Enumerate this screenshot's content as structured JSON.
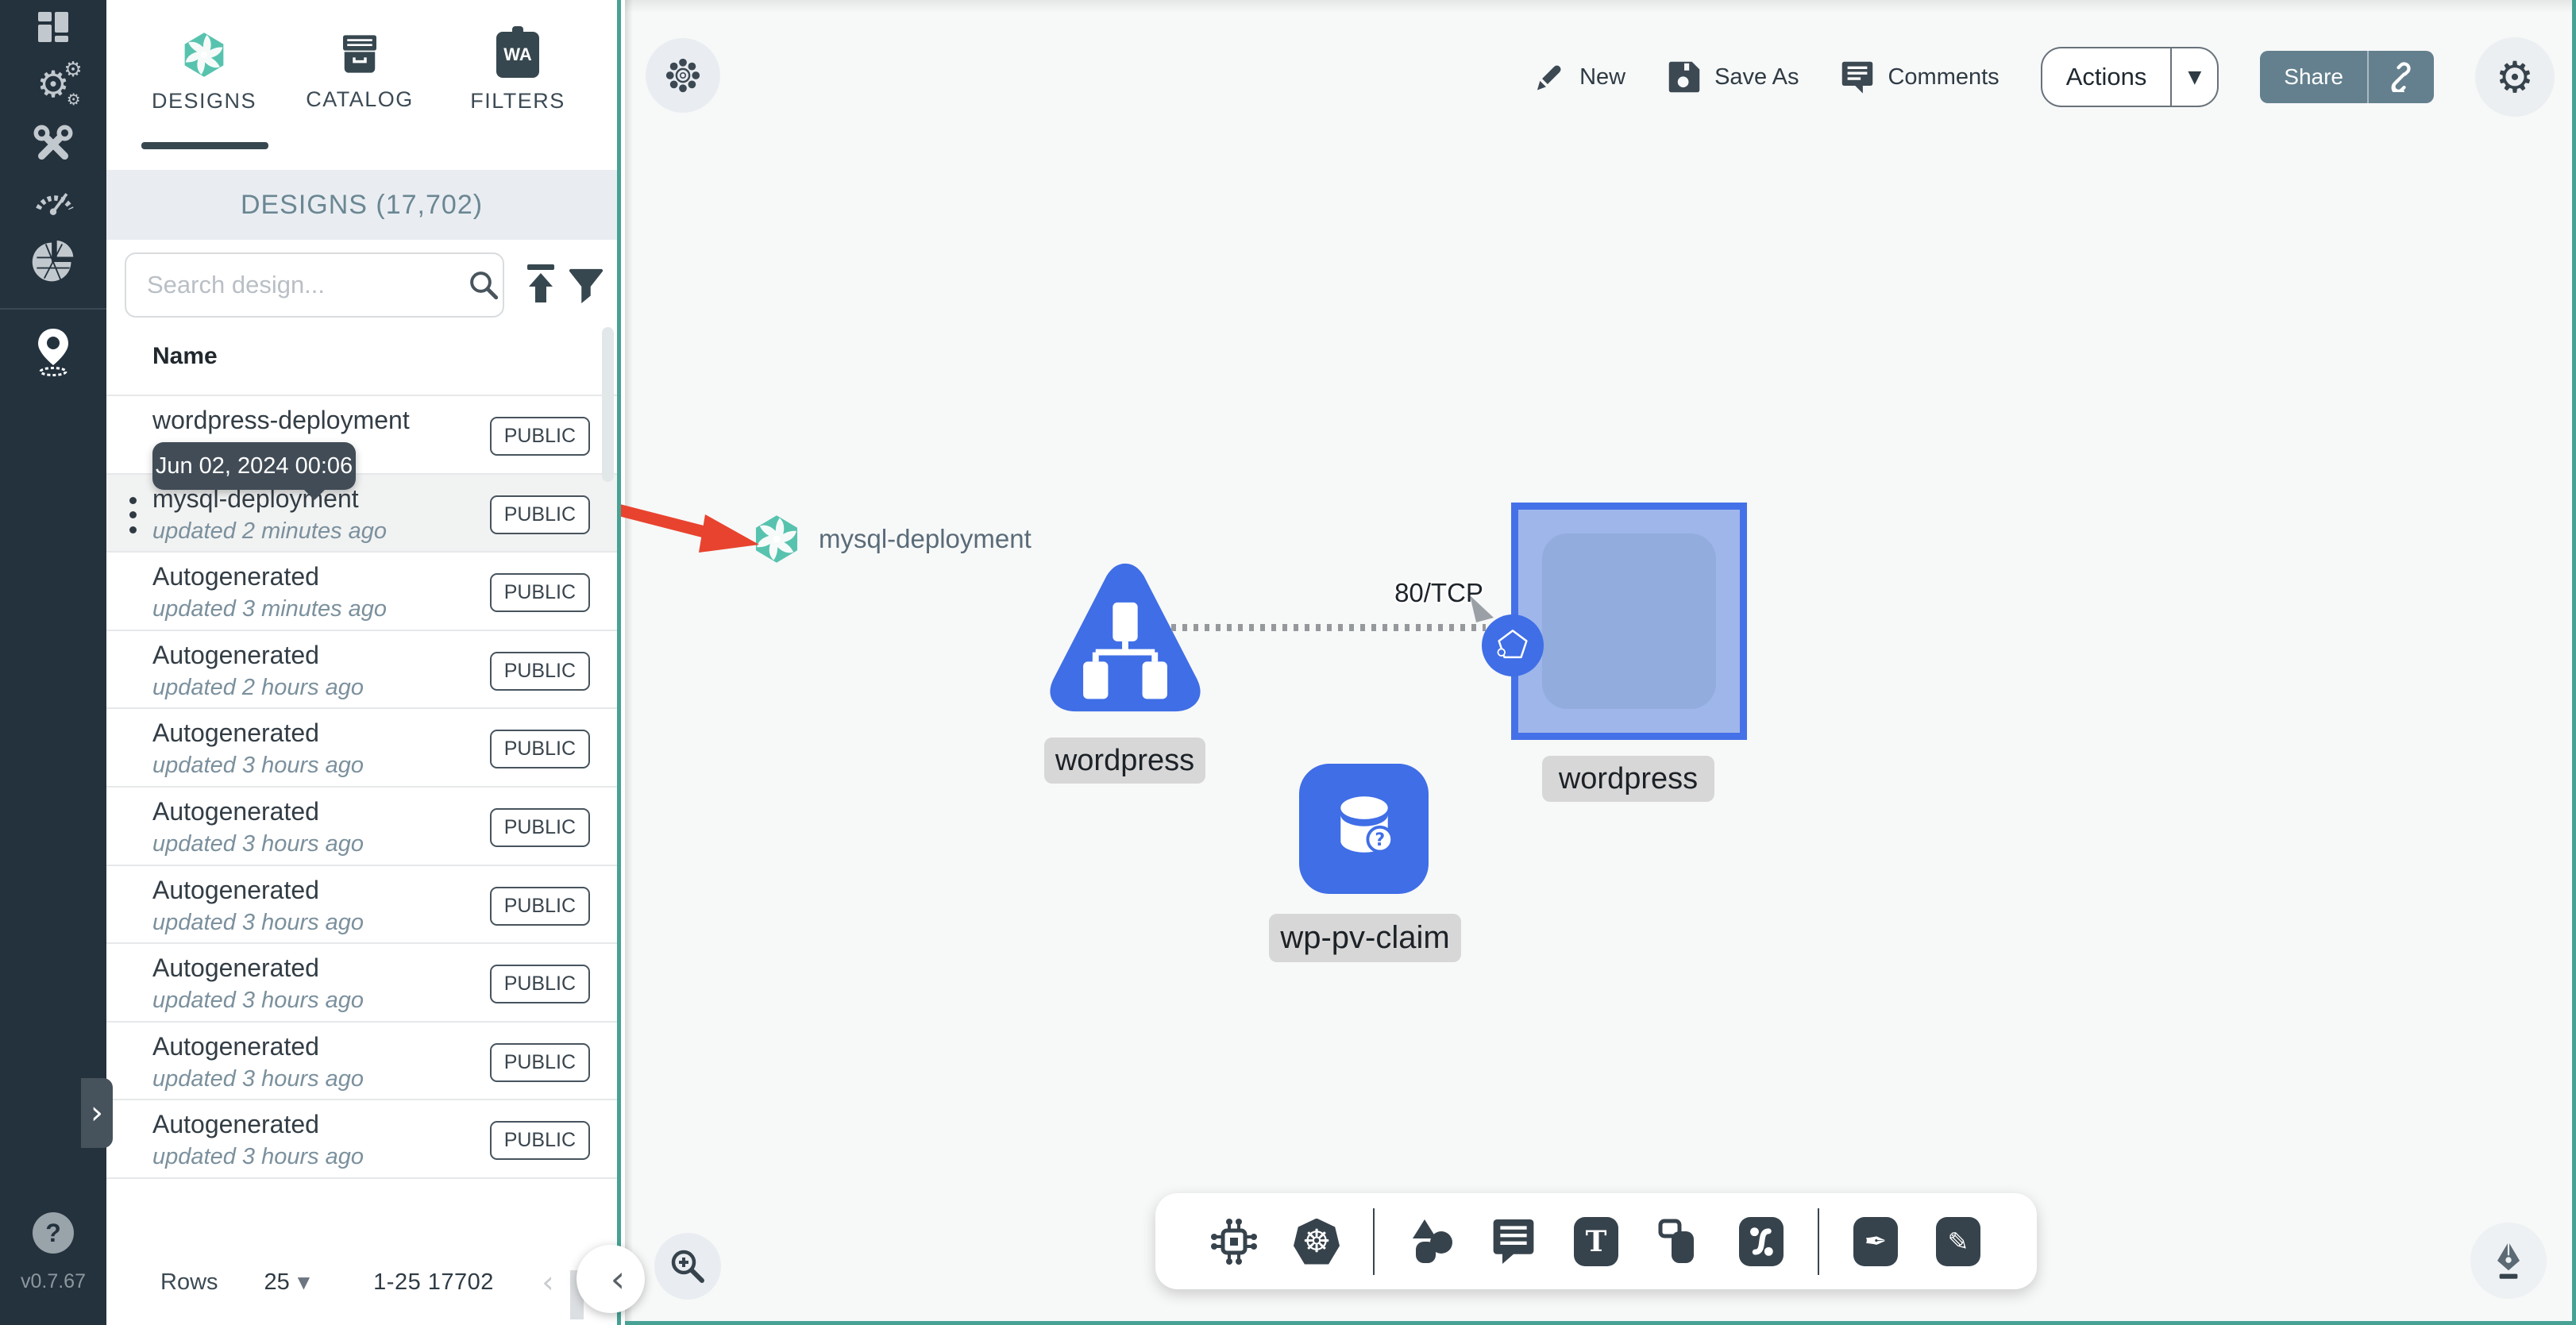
{
  "version": "v0.7.67",
  "colors": {
    "teal": "#47a295",
    "blue": "#3f6ee6",
    "red": "#e8432e",
    "share_slate": "#64808e",
    "rail": "#24323e"
  },
  "sidebar": {
    "items": [
      {
        "name": "dashboard"
      },
      {
        "name": "lifecycle"
      },
      {
        "name": "configuration"
      },
      {
        "name": "performance"
      },
      {
        "name": "extensions"
      },
      {
        "name": "kanvas-pin"
      }
    ],
    "help_label": "?"
  },
  "tabs": [
    {
      "label": "DESIGNS",
      "active": true
    },
    {
      "label": "CATALOG",
      "active": false
    },
    {
      "label": "FILTERS",
      "active": false,
      "icon_text": "WA"
    }
  ],
  "panel": {
    "header": "DESIGNS (17,702)",
    "search_placeholder": "Search design...",
    "name_header": "Name",
    "tooltip": "Jun 02, 2024 00:06",
    "rows": [
      {
        "name": "wordpress-deployment",
        "updated": "",
        "badge": "PUBLIC",
        "hover": false,
        "kebab": false
      },
      {
        "name": "mysql-deployment",
        "updated": "updated 2 minutes ago",
        "badge": "PUBLIC",
        "hover": true,
        "kebab": true
      },
      {
        "name": "Autogenerated",
        "updated": "updated 3 minutes ago",
        "badge": "PUBLIC",
        "hover": false,
        "kebab": false
      },
      {
        "name": "Autogenerated",
        "updated": "updated 2 hours ago",
        "badge": "PUBLIC",
        "hover": false,
        "kebab": false
      },
      {
        "name": "Autogenerated",
        "updated": "updated 3 hours ago",
        "badge": "PUBLIC",
        "hover": false,
        "kebab": false
      },
      {
        "name": "Autogenerated",
        "updated": "updated 3 hours ago",
        "badge": "PUBLIC",
        "hover": false,
        "kebab": false
      },
      {
        "name": "Autogenerated",
        "updated": "updated 3 hours ago",
        "badge": "PUBLIC",
        "hover": false,
        "kebab": false
      },
      {
        "name": "Autogenerated",
        "updated": "updated 3 hours ago",
        "badge": "PUBLIC",
        "hover": false,
        "kebab": false
      },
      {
        "name": "Autogenerated",
        "updated": "updated 3 hours ago",
        "badge": "PUBLIC",
        "hover": false,
        "kebab": false
      },
      {
        "name": "Autogenerated",
        "updated": "updated 3 hours ago",
        "badge": "PUBLIC",
        "hover": false,
        "kebab": false
      }
    ],
    "pagination": {
      "rows_label": "Rows",
      "per_page": "25",
      "range": "1-25 17702"
    }
  },
  "topbar": {
    "new_label": "New",
    "save_as_label": "Save As",
    "comments_label": "Comments",
    "actions_label": "Actions",
    "share_label": "Share"
  },
  "canvas": {
    "annotation": "mysql-deployment",
    "edge_label": "80/TCP",
    "node_triangle_label": "wordpress",
    "node_square_label": "wordpress",
    "node_pvc_label": "wp-pv-claim",
    "text_tool_label": "T"
  },
  "icons": [
    "meshery-pinwheel",
    "catalog-archive",
    "wasm-filter",
    "search",
    "upload",
    "filter-funnel",
    "kebab-menu",
    "pencil-new",
    "save-floppy",
    "comments-bubble",
    "caret-down",
    "share-link",
    "settings-gear",
    "asterisk-wheel",
    "zoom-in-magnifier",
    "collapse-chevron",
    "component-chip",
    "kubernetes-wheel",
    "shapes",
    "notes",
    "text-tool",
    "copy-shapes",
    "connect-curve",
    "pen-tool",
    "pencil-tool",
    "pen-nib",
    "dashboard-grid",
    "gears",
    "wrenches",
    "gauge",
    "pie-triangles",
    "location-pin",
    "question-help"
  ]
}
